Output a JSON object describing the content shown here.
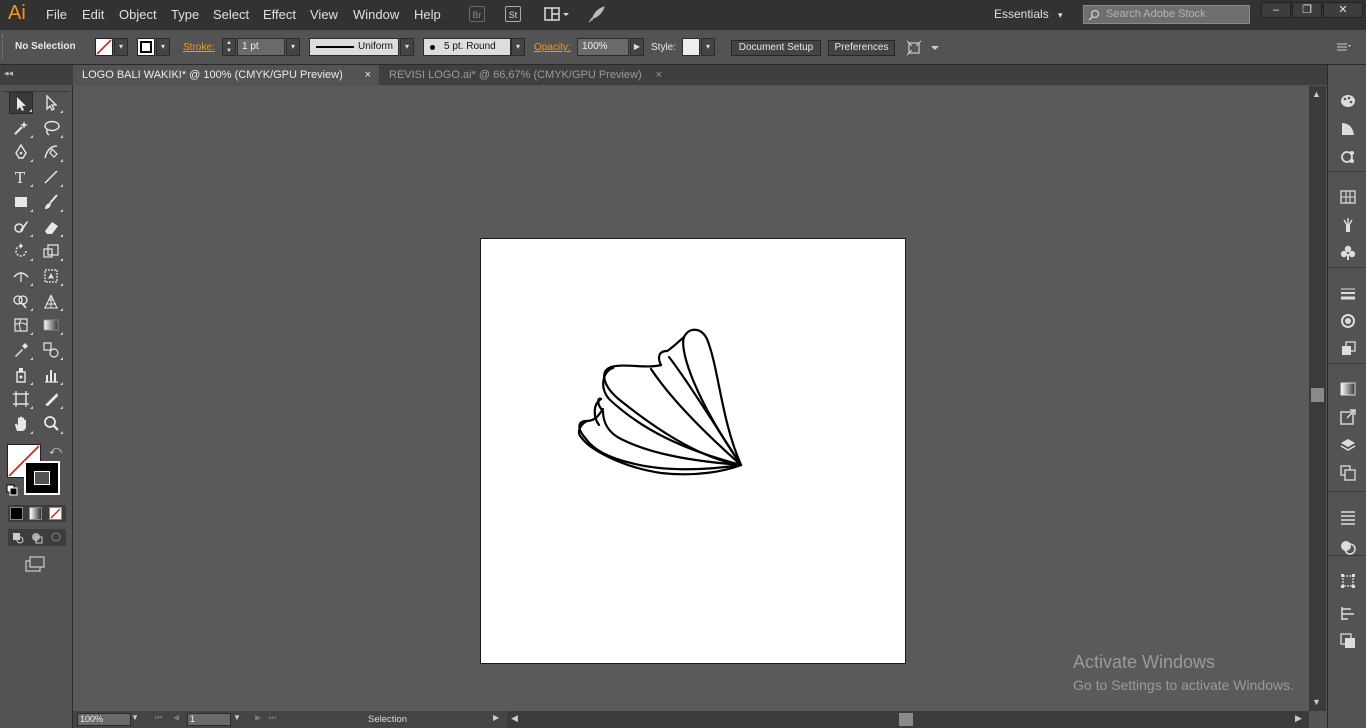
{
  "app": {
    "logo": "Ai"
  },
  "menu": [
    "File",
    "Edit",
    "Object",
    "Type",
    "Select",
    "Effect",
    "View",
    "Window",
    "Help"
  ],
  "menubar_buttons": {
    "bridge": "Br",
    "stock": "St"
  },
  "workspace": {
    "label": "Essentials",
    "caret": "▾"
  },
  "search": {
    "placeholder": "Search Adobe Stock"
  },
  "window_controls": {
    "minimize": "–",
    "restore": "❐",
    "close": "✕"
  },
  "control": {
    "selection_status": "No Selection",
    "stroke_label": "Stroke:",
    "stroke_weight": "1 pt",
    "stroke_profile": "Uniform",
    "brush": "5 pt. Round",
    "opacity_label": "Opacity:",
    "opacity_value": "100%",
    "style_label": "Style:",
    "document_setup": "Document Setup",
    "preferences": "Preferences"
  },
  "tabs": [
    {
      "label": "LOGO BALI WAKIKI* @ 100% (CMYK/GPU Preview)",
      "close": "×",
      "active": true
    },
    {
      "label": "REVISI LOGO.ai* @ 66,67% (CMYK/GPU Preview)",
      "close": "×",
      "active": false
    }
  ],
  "status": {
    "zoom": "100%",
    "artboard": "1",
    "tool": "Selection"
  },
  "watermark": {
    "title": "Activate Windows",
    "subtitle": "Go to Settings to activate Windows."
  },
  "colors": {
    "accent": "#f7941e",
    "menubar": "#323232",
    "panel": "#535353",
    "canvas": "#5a5a5a",
    "artboard": "#ffffff"
  },
  "icons": {
    "tools": [
      "selection-tool-icon",
      "direct-selection-tool-icon",
      "magic-wand-tool-icon",
      "lasso-tool-icon",
      "pen-tool-icon",
      "curvature-tool-icon",
      "type-tool-icon",
      "line-segment-tool-icon",
      "rectangle-tool-icon",
      "paintbrush-tool-icon",
      "shaper-tool-icon",
      "eraser-tool-icon",
      "rotate-tool-icon",
      "scale-tool-icon",
      "width-tool-icon",
      "free-transform-tool-icon",
      "shape-builder-tool-icon",
      "perspective-grid-tool-icon",
      "mesh-tool-icon",
      "gradient-tool-icon",
      "eyedropper-tool-icon",
      "blend-tool-icon",
      "symbol-sprayer-tool-icon",
      "column-graph-tool-icon",
      "artboard-tool-icon",
      "slice-tool-icon",
      "hand-tool-icon",
      "zoom-tool-icon"
    ],
    "panels": [
      "color-panel-icon",
      "color-guide-panel-icon",
      "color-themes-panel-icon",
      "swatches-panel-icon",
      "brushes-panel-icon",
      "symbols-panel-icon",
      "stroke-panel-icon",
      "appearance-panel-icon",
      "graphic-styles-panel-icon",
      "gradient-panel-icon",
      "export-panel-icon",
      "layers-panel-icon",
      "artboards-panel-icon",
      "align-panel-icon",
      "pathfinder-panel-icon",
      "transform-panel-icon",
      "properties-panel-icon",
      "links-panel-icon"
    ]
  }
}
